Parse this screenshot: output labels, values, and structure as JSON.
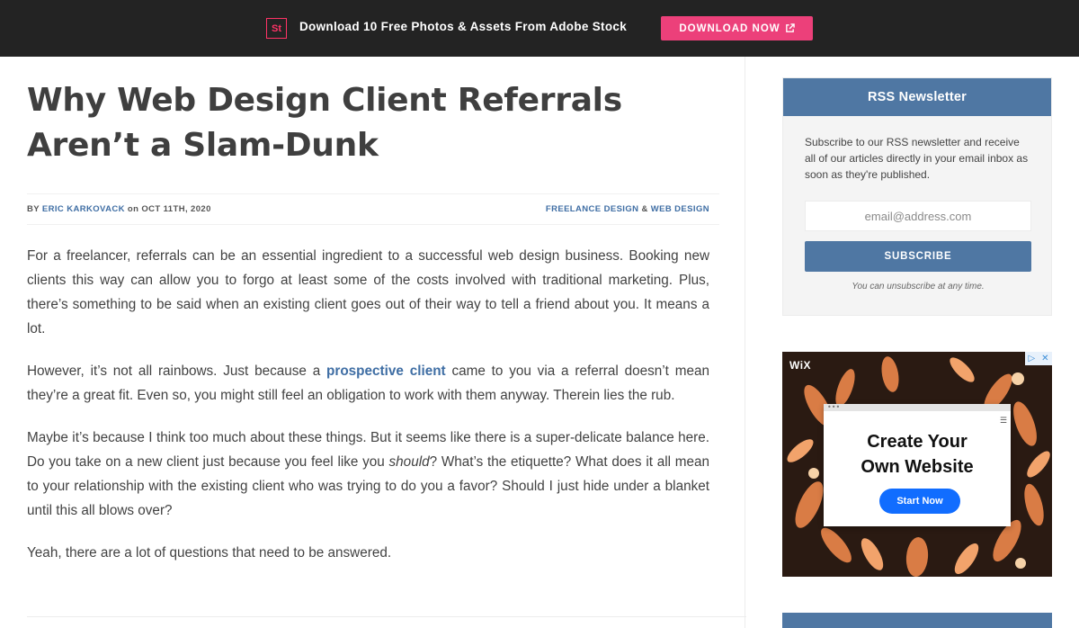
{
  "promo": {
    "logo": "St",
    "text": "Download 10 Free Photos & Assets From Adobe Stock",
    "button": "DOWNLOAD NOW"
  },
  "article": {
    "title": "Why Web Design Client Referrals Aren’t a Slam-Dunk",
    "meta": {
      "by": "BY",
      "author": "ERIC KARKOVACK",
      "on": "on",
      "date": "OCT 11TH, 2020",
      "category1": "FREELANCE DESIGN",
      "amp": "&",
      "category2": "WEB DESIGN"
    },
    "paragraphs": {
      "p1": "For a freelancer, referrals can be an essential ingredient to a successful web design business. Booking new clients this way can allow you to forgo at least some of the costs involved with traditional marketing. Plus, there’s something to be said when an existing client goes out of their way to tell a friend about you. It means a lot.",
      "p2_before": "However, it’s not all rainbows. Just because a ",
      "p2_link": "prospective client",
      "p2_after": " came to you via a referral doesn’t mean they’re a great fit. Even so, you might still feel an obligation to work with them anyway. Therein lies the rub.",
      "p3_before": "Maybe it’s because I think too much about these things. But it seems like there is a super-delicate balance here. Do you take on a new client just because you feel like you ",
      "p3_em": "should",
      "p3_after": "? What’s the etiquette? What does it all mean to your relationship with the existing client who was trying to do you a favor? Should I just hide under a blanket until this all blows over?",
      "p4": "Yeah, there are a lot of questions that need to be answered."
    }
  },
  "sidebar": {
    "rss": {
      "title": "RSS Newsletter",
      "description": "Subscribe to our RSS newsletter and receive all of our articles directly in your email inbox as soon as they're published.",
      "placeholder": "email@address.com",
      "button": "SUBSCRIBE",
      "note": "You can unsubscribe at any time."
    },
    "ad": {
      "brand": "WiX",
      "headline_line1": "Create Your",
      "headline_line2": "Own Website",
      "button": "Start Now"
    }
  },
  "colors": {
    "accent": "#4f77a3",
    "promo_bg": "#232323",
    "promo_button": "#ec407a",
    "link": "#3f6ea4"
  }
}
